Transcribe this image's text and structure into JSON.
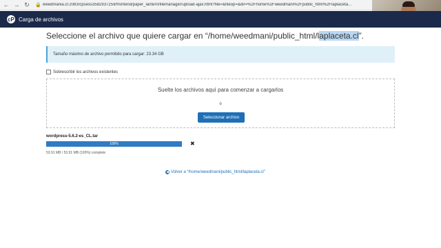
{
  "browser": {
    "back_icon": "arrow-left-icon",
    "forward_icon": "arrow-right-icon",
    "reload_icon": "reload-icon",
    "url": "weedmania.cl:2083/cpsess3582937259/frontend/paper_lantern/filemanager/upload-ajax.html?file=&fileop=&dir=%2Fhome%2Fweedmani%2Fpublic_html%2Flaplaceta..."
  },
  "header": {
    "title": "Carga de archivos",
    "logo": "cpanel-logo"
  },
  "page": {
    "title_prefix": "Seleccione el archivo que quiere cargar en “/home/weedmani/public_html/l",
    "title_highlight": "aplaceta.cl",
    "title_suffix": "”."
  },
  "info": {
    "text": "Tamaño máximo de archivo permitido para cargar: 23.34 GB"
  },
  "overwrite": {
    "label": "Sobrescribir los archivos existentes",
    "checked": false
  },
  "dropzone": {
    "text": "Suelte los archivos aquí para comenzar a cargarlos",
    "or": "o",
    "button": "Seleccionar archivo"
  },
  "upload": {
    "file_name": "wordpress-5.6.2-es_CL.tar",
    "progress_percent": 100,
    "progress_label": "100%",
    "cancel": "✖",
    "status": "53.91 MB / 53.91 MB (100%) complete"
  },
  "back": {
    "label": "Volver a “/home/weedmani/public_html/laplaceta.cl”"
  },
  "colors": {
    "header_bg": "#1b2a4a",
    "accent": "#1f6fb6",
    "info_bg": "#dff0f8"
  }
}
